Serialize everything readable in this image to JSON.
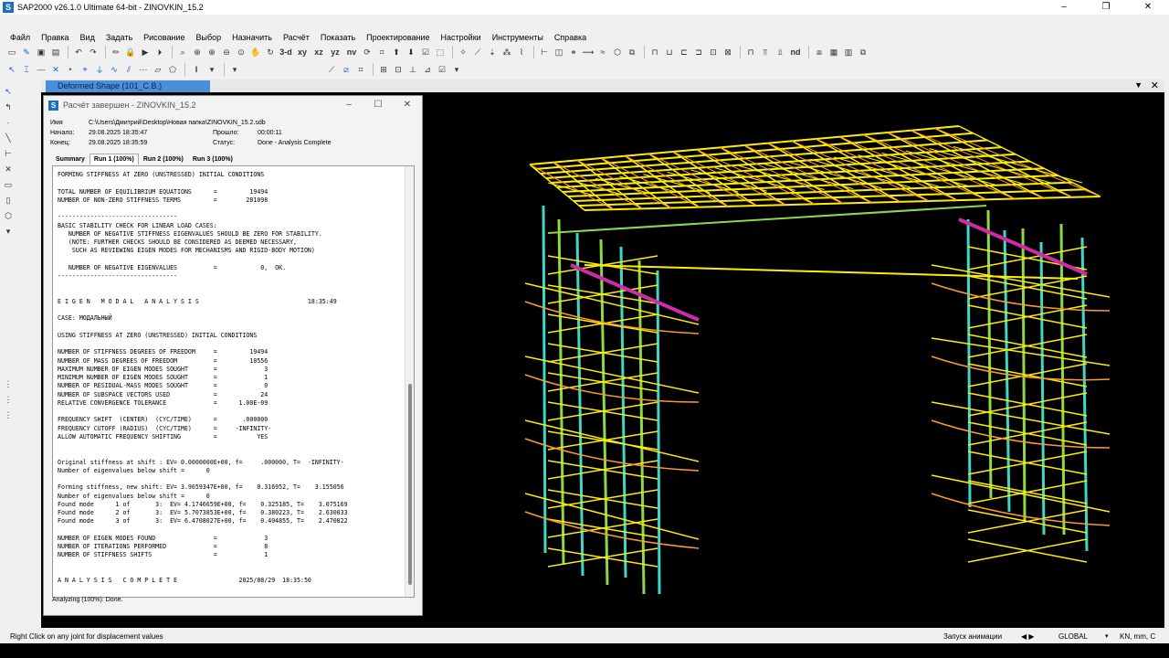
{
  "window": {
    "title": "SAP2000 v26.1.0 Ultimate 64-bit - ZINOVKIN_15.2",
    "app_icon": "S",
    "controls": [
      "–",
      "❐",
      "✕"
    ]
  },
  "menu": [
    "Файл",
    "Правка",
    "Вид",
    "Задать",
    "Рисование",
    "Выбор",
    "Назначить",
    "Расчёт",
    "Показать",
    "Проектирование",
    "Настройки",
    "Инструменты",
    "Справка"
  ],
  "toolbar": {
    "view_labels": [
      "3-d",
      "xy",
      "xz",
      "yz",
      "nv"
    ],
    "nd_label": "nd",
    "text_icon": "I"
  },
  "document": {
    "tab_label": "Deformed Shape (101_C.B.)",
    "dropdown": "▼",
    "close": "✕"
  },
  "dialog": {
    "title": "Расчёт завершен - ZINOVKIN_15.2",
    "controls": [
      "–",
      "☐",
      "✕"
    ],
    "name_label": "Имя",
    "name_value": "C:\\Users\\Дмитрий\\Desktop\\Новая папка\\ZINOVKIN_15.2.sdb",
    "start_label": "Начало:",
    "start_value": "29.08.2025  18:35:47",
    "end_label": "Конец:",
    "end_value": "29.08.2025  18:35:59",
    "elapsed_label": "Прошло:",
    "elapsed_value": "00:00:11",
    "status_label": "Статус:",
    "status_value": "Done - Analysis Complete",
    "tabs": [
      "Summary",
      "Run 1 (100%)",
      "Run 2 (100%)",
      "Run 3 (100%)"
    ],
    "log": "FORMING STIFFNESS AT ZERO (UNSTRESSED) INITIAL CONDITIONS\n\nTOTAL NUMBER OF EQUILIBRIUM EQUATIONS      =         19494\nNUMBER OF NON-ZERO STIFFNESS TERMS         =        281098\n\n---------------------------------\nBASIC STABILITY CHECK FOR LINEAR LOAD CASES:\n   NUMBER OF NEGATIVE STIFFNESS EIGENVALUES SHOULD BE ZERO FOR STABILITY.\n   (NOTE: FURTHER CHECKS SHOULD BE CONSIDERED AS DEEMED NECESSARY,\n    SUCH AS REVIEWING EIGEN MODES FOR MECHANISMS AND RIGID-BODY MOTION)\n\n   NUMBER OF NEGATIVE EIGENVALUES          =            0,  OK.\n---------------------------------\n\n\nE I G E N   M O D A L   A N A L Y S I S                              18:35:49\n\nCASE: МОДАЛЬНЫЙ\n\nUSING STIFFNESS AT ZERO (UNSTRESSED) INITIAL CONDITIONS\n\nNUMBER OF STIFFNESS DEGREES OF FREEDOM     =         19494\nNUMBER OF MASS DEGREES OF FREEDOM          =         10556\nMAXIMUM NUMBER OF EIGEN MODES SOUGHT       =             3\nMINIMUM NUMBER OF EIGEN MODES SOUGHT       =             1\nNUMBER OF RESIDUAL-MASS MODES SOUGHT       =             0\nNUMBER OF SUBSPACE VECTORS USED            =            24\nRELATIVE CONVERGENCE TOLERANCE             =      1.00E-09\n\nFREQUENCY SHIFT  (CENTER)  (CYC/TIME)      =       .000000\nFREQUENCY CUTOFF (RADIUS)  (CYC/TIME)      =     -INFINITY-\nALLOW AUTOMATIC FREQUENCY SHIFTING         =           YES\n\n\nOriginal stiffness at shift : EV= 0.0000000E+00, f=     .000000, T=  -INFINITY-\nNumber of eigenvalues below shift =      0\n\nForming stiffness, new shift: EV= 3.9659347E+00, f=    0.316952, T=    3.155056\nNumber of eigenvalues below shift =      0\nFound mode      1 of       3:  EV= 4.1746659E+00, f=    0.325185, T=    3.075169\nFound mode      2 of       3:  EV= 5.7073853E+00, f=    0.380223, T=    2.630033\nFound mode      3 of       3:  EV= 6.4708027E+00, f=    0.404855, T=    2.470022\n\nNUMBER OF EIGEN MODES FOUND                =             3\nNUMBER OF ITERATIONS PERFORMED             =             8\nNUMBER OF STIFFNESS SHIFTS                 =             1\n\n\nA N A L Y S I S   C O M P L E T E                 2025/08/29  18:35:50",
    "status_line": "Analyzing (100%):  Done."
  },
  "statusbar": {
    "hint": "Right Click on any joint for displacement values",
    "animation": "Запуск анимации",
    "nav": "◀   ▶",
    "coord_system": "GLOBAL",
    "units": "KN, mm, C",
    "dropdown": "▾"
  },
  "colors": {
    "viewport_bg": "#000000",
    "member_yellow": "#ffee00",
    "member_green": "#8ed64a",
    "member_cyan": "#3fd8c8",
    "member_orange": "#ff9a2e",
    "member_magenta": "#d02aa8",
    "tab_active": "#4a8fd8"
  },
  "icons": [
    "open-icon",
    "save-icon",
    "undo-icon",
    "redo-icon",
    "lock-icon",
    "run-icon",
    "zoom-icon",
    "pan-icon",
    "pointer-icon",
    "frame-icon"
  ]
}
